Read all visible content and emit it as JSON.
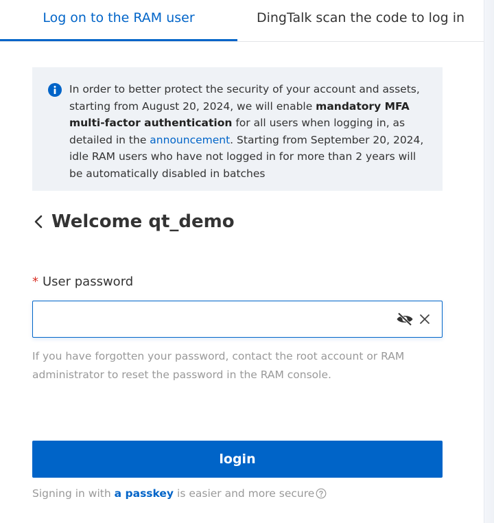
{
  "tabs": {
    "ram_user": "Log on to the RAM user",
    "dingtalk": "DingTalk scan the code to log in"
  },
  "notice": {
    "icon": "info-icon",
    "part1": "In order to better protect the security of your account and assets, starting from August 20, 2024, we will enable ",
    "bold": "mandatory MFA multi-factor authentication",
    "part2": " for all users when logging in, as detailed in the ",
    "link": "announcement",
    "part3": ". Starting from September 20, 2024, idle RAM users who have not logged in for more than 2 years will be automatically disabled in batches"
  },
  "welcome": {
    "back_icon": "chevron-left-icon",
    "title": "Welcome qt_demo"
  },
  "password": {
    "required_mark": "*",
    "label": "User password",
    "value": "",
    "placeholder": "",
    "eye_icon": "eye-slash-icon",
    "clear_icon": "close-icon",
    "hint": "If you have forgotten your password, contact the root account or RAM administrator to reset the password in the RAM console."
  },
  "login_button": "login",
  "passkey": {
    "before": "Signing in with",
    "link": "a passkey",
    "after": "is easier and more secure",
    "help_icon": "question-circle-icon"
  },
  "colors": {
    "accent": "#0064c8",
    "notice_bg": "#eff2f6",
    "required": "#d93026",
    "hint_text": "#999999"
  }
}
